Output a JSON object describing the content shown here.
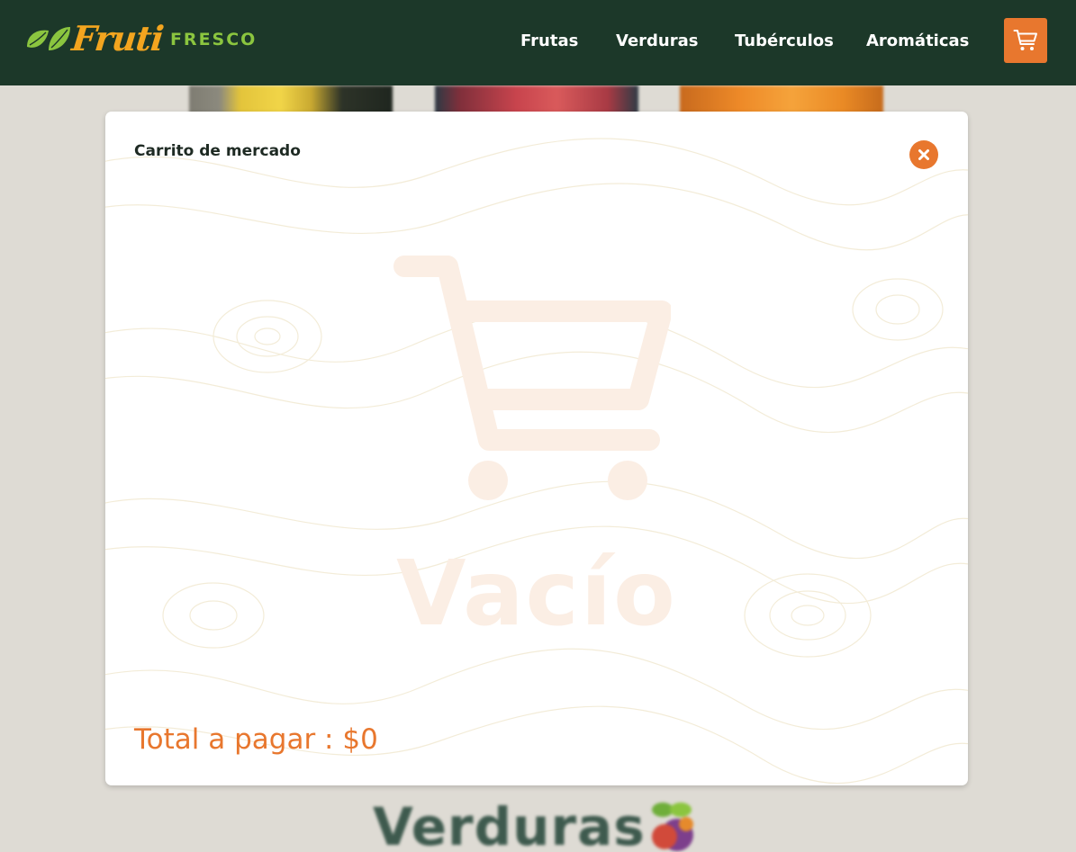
{
  "brand": {
    "name_script": "Fruti",
    "name_caps": "FRESCO"
  },
  "nav": {
    "items": [
      {
        "label": "Frutas"
      },
      {
        "label": "Verduras"
      },
      {
        "label": "Tubérculos"
      },
      {
        "label": "Aromáticas"
      }
    ],
    "cart_icon": "shopping-cart-icon"
  },
  "cart_modal": {
    "title": "Carrito de mercado",
    "close_icon": "close-icon",
    "empty_icon": "shopping-cart-icon",
    "empty_text": "Vacío",
    "total_text": "Total a pagar : $0"
  },
  "background_page": {
    "section_heading": "Verduras"
  },
  "colors": {
    "header_bg": "#1c3829",
    "accent_orange": "#e8772e",
    "brand_yellow": "#f3a51f",
    "brand_green": "#8bc53f",
    "empty_state": "#fbeee4"
  }
}
